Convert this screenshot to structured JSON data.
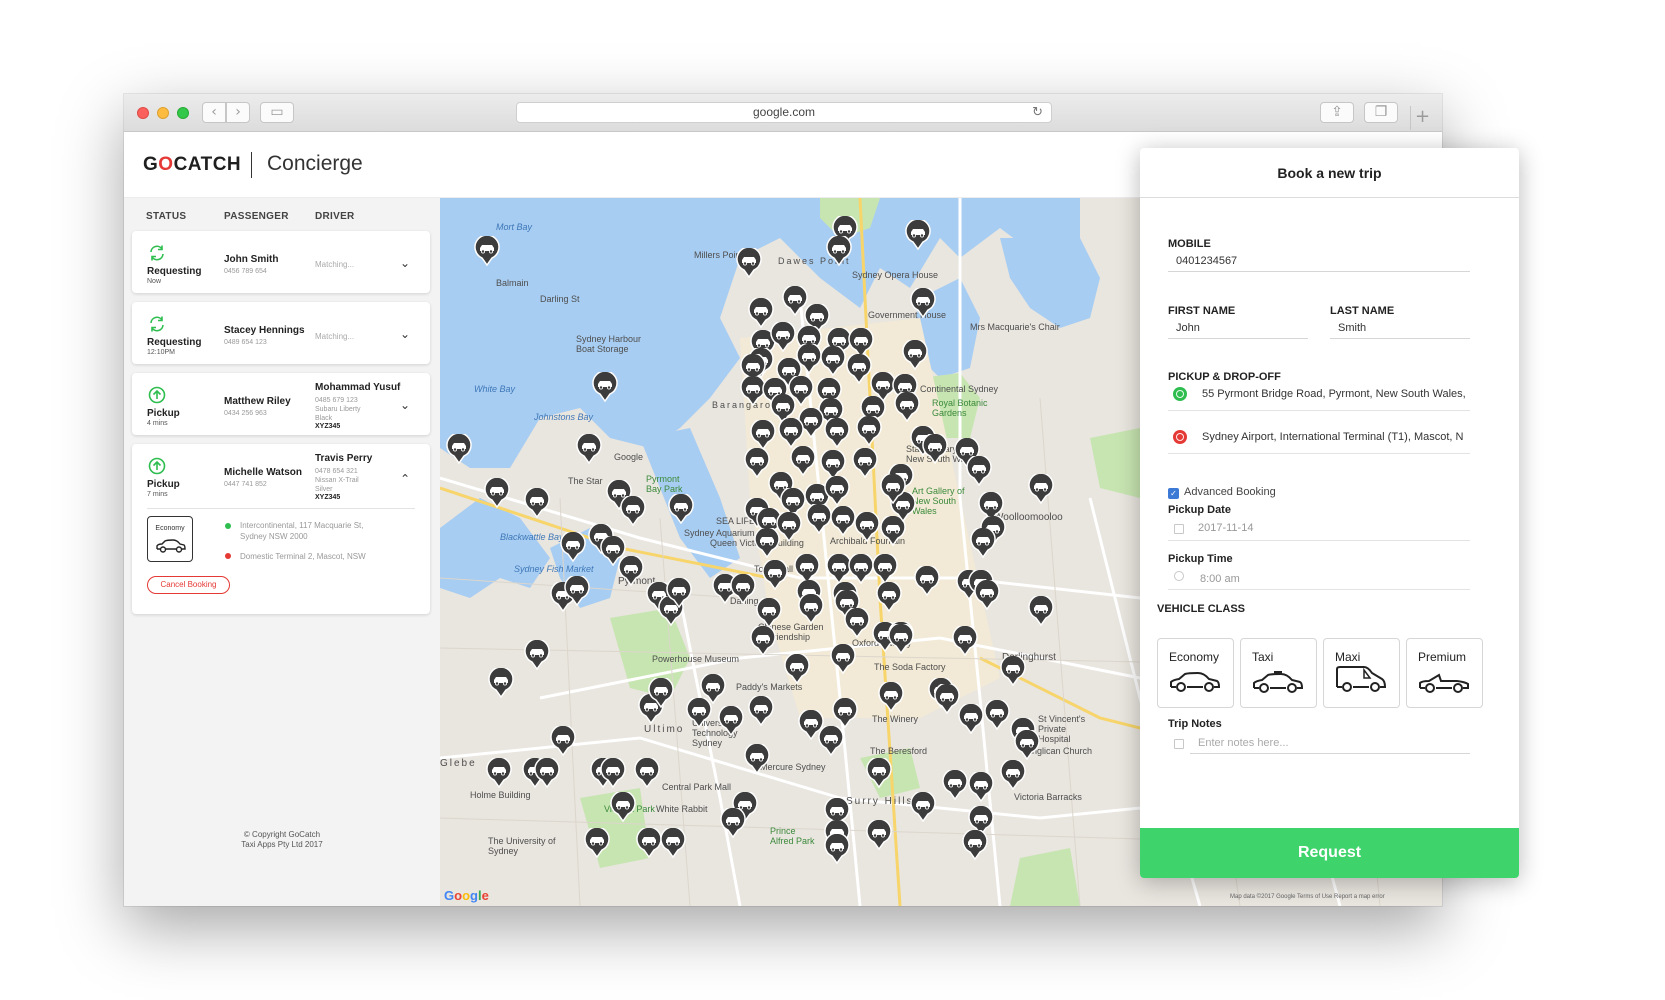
{
  "browser": {
    "url": "google.com"
  },
  "app": {
    "brand": [
      "G",
      "O",
      "CATCH"
    ],
    "module": "Concierge"
  },
  "sidebar": {
    "columns": [
      "STATUS",
      "PASSENGER",
      "DRIVER"
    ],
    "trips": [
      {
        "status": "Requesting",
        "status_time": "Now",
        "passenger": "John Smith",
        "phone": "0456 789 654",
        "driver_status": "Matching..."
      },
      {
        "status": "Requesting",
        "status_time": "12:10PM",
        "passenger": "Stacey Hennings",
        "phone": "0489 654 123",
        "driver_status": "Matching..."
      },
      {
        "status": "Pickup",
        "status_time": "4 mins",
        "passenger": "Matthew Riley",
        "phone": "0434 256 963",
        "driver": "Mohammad Yusuf",
        "driver_phone": "0485 679 123",
        "car": "Subaru Liberty",
        "car_color": "Black",
        "plate": "XYZ345"
      },
      {
        "status": "Pickup",
        "status_time": "7 mins",
        "passenger": "Michelle Watson",
        "phone": "0447 741 852",
        "driver": "Travis Perry",
        "driver_phone": "0478 654 321",
        "car": "Nissan X-Trail",
        "car_color": "Silver",
        "plate": "XYZ345",
        "vehicle_class": "Economy",
        "pickup_line1": "Intercontinental, 117 Macquarie St,",
        "pickup_line2": "Sydney NSW 2000",
        "dropoff": "Domestic Terminal 2, Mascot, NSW",
        "cancel_label": "Cancel Booking"
      }
    ],
    "copyright_line1": "© Copyright GoCatch",
    "copyright_line2": "Taxi Apps Pty Ltd 2017"
  },
  "map": {
    "labels": [
      "Mort Bay",
      "Millers Point",
      "Dawes Point",
      "Sydney Opera House",
      "Balmain",
      "Darling St",
      "Government House",
      "Mrs Macquarie's Chair",
      "Sydney Harbour Boat Storage",
      "White Bay",
      "Johnstons Bay",
      "Barangaroo",
      "Continental Sydney",
      "Royal Botanic Gardens",
      "State Library of New South Wales",
      "Google",
      "The Star",
      "Pyrmont Bay Park",
      "Art Gallery of New South Wales",
      "Woolloomooloo",
      "Blackwattle Bay",
      "Sydney Aquarium",
      "SEA LIFE",
      "Queen Victoria Building",
      "Archibald Fountain",
      "Sydney Fish Market",
      "Pyrmont",
      "Town Hall",
      "Darling",
      "Chinese Garden of Friendship",
      "Oxford Factory",
      "Powerhouse Museum",
      "Paddy's Markets",
      "The Soda Factory",
      "Darlinghurst",
      "Ultimo",
      "University of Technology Sydney",
      "The Winery",
      "Mercure Sydney",
      "The Beresford",
      "Glebe",
      "Central Park Mall",
      "Victoria Park",
      "White Rabbit",
      "Surry Hills",
      "Holme Building",
      "The University of Sydney",
      "Prince Alfred Park",
      "Victoria Barracks",
      "St Vincent's Private Hospital",
      "Anglican Church"
    ],
    "credit": "Map data ©2017 Google   Terms of Use   Report a map error",
    "google_logo": "Google"
  },
  "booking": {
    "title": "Book a new trip",
    "mobile_label": "MOBILE",
    "mobile_value": "0401234567",
    "first_name_label": "FIRST NAME",
    "first_name_value": "John",
    "last_name_label": "LAST NAME",
    "last_name_value": "Smith",
    "route_label": "PICKUP & DROP-OFF",
    "pickup": "55 Pyrmont Bridge Road, Pyrmont, New South Wales,",
    "dropoff": "Sydney Airport, International Terminal (T1), Mascot, N",
    "advanced_label": "Advanced Booking",
    "advanced_checked": true,
    "date_label": "Pickup Date",
    "date_value": "2017-11-14",
    "time_label": "Pickup Time",
    "time_value": "8:00 am",
    "vehicle_label": "VEHICLE CLASS",
    "vehicles": [
      "Economy",
      "Taxi",
      "Maxi",
      "Premium"
    ],
    "notes_label": "Trip Notes",
    "notes_placeholder": "Enter notes here...",
    "request_label": "Request"
  },
  "colors": {
    "brand_red": "#e53935",
    "request_green": "#3ed36b",
    "pickup_dot": "#2ebd4e",
    "dropoff_dot": "#e53935",
    "status_green": "#2ebd4e",
    "water": "#a8cdf2",
    "park": "#c7e5b1"
  }
}
